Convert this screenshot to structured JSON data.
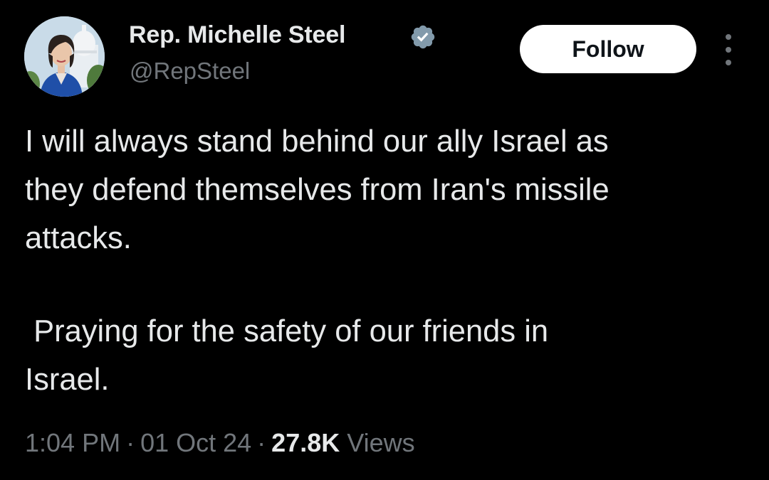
{
  "author": {
    "display_name": "Rep. Michelle Steel",
    "handle": "@RepSteel",
    "verified_icon": "verified-badge-icon",
    "avatar_icon": "profile-avatar"
  },
  "actions": {
    "follow_label": "Follow",
    "more_icon": "more-vertical-icon"
  },
  "tweet": {
    "paragraph_1_line_1": "I will always stand behind our ally Israel as",
    "paragraph_1_line_2": "they defend themselves from Iran's missile",
    "paragraph_1_line_3": "attacks.",
    "paragraph_2_line_1": " Praying for the safety of our friends in",
    "paragraph_2_line_2": "Israel."
  },
  "meta": {
    "time": "1:04 PM",
    "separator": "·",
    "date": "01 Oct 24",
    "views_count": "27.8K",
    "views_label": "Views"
  },
  "colors": {
    "background": "#000000",
    "primary_text": "#e7e9ea",
    "secondary_text": "#71767b",
    "follow_bg": "#ffffff",
    "verified": "#829aab"
  }
}
